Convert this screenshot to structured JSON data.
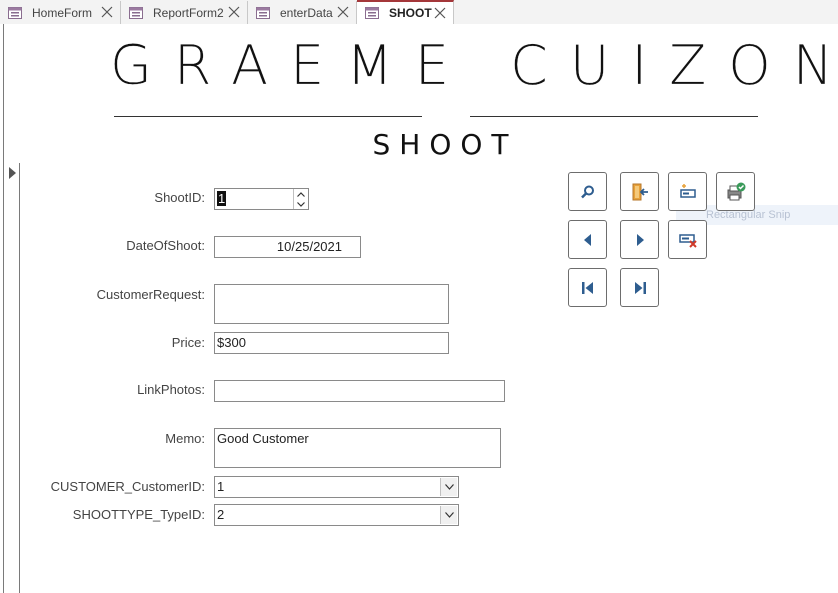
{
  "tabs": [
    {
      "label": "HomeForm",
      "active": false
    },
    {
      "label": "ReportForm2",
      "active": false
    },
    {
      "label": "enterData",
      "active": false
    },
    {
      "label": "SHOOT",
      "active": true
    }
  ],
  "header": {
    "title": "GRAEME CUIZON",
    "subtitle": "SHOOT"
  },
  "form": {
    "shoot_id": {
      "label": "ShootID:",
      "value": "1"
    },
    "date_of_shoot": {
      "label": "DateOfShoot:",
      "value": "10/25/2021"
    },
    "customer_request": {
      "label": "CustomerRequest:",
      "value": ""
    },
    "price": {
      "label": "Price:",
      "value": "$300"
    },
    "link_photos": {
      "label": "LinkPhotos:",
      "value": ""
    },
    "memo": {
      "label": "Memo:",
      "value": "Good Customer"
    },
    "customer_id": {
      "label": "CUSTOMER_CustomerID:",
      "value": "1"
    },
    "shoot_type_id": {
      "label": "SHOOTTYPE_TypeID:",
      "value": "2"
    }
  },
  "buttons": [
    {
      "icon": "search-icon"
    },
    {
      "icon": "exit-door-icon"
    },
    {
      "icon": "new-record-icon"
    },
    {
      "icon": "save-print-icon"
    },
    {
      "icon": "previous-record-icon"
    },
    {
      "icon": "next-record-icon"
    },
    {
      "icon": "delete-record-icon"
    },
    {
      "icon": "first-record-icon"
    },
    {
      "icon": "last-record-icon"
    }
  ],
  "ghost_tooltip": "Rectangular Snip",
  "colors": {
    "accent_tab": "#a4373a",
    "icon_blue": "#2e5d8f"
  }
}
